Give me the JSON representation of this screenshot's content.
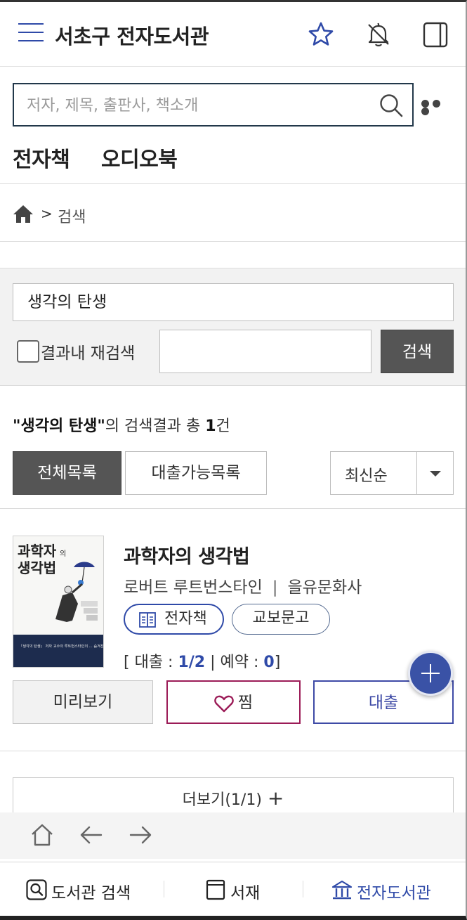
{
  "header": {
    "title": "서초구 전자도서관",
    "icons": [
      "menu-icon",
      "star-icon",
      "bell-off-icon",
      "bookshelf-icon"
    ]
  },
  "search": {
    "placeholder": "저자, 제목, 출판사, 책소개"
  },
  "media_tabs": [
    "전자책",
    "오디오북"
  ],
  "breadcrumb": {
    "separator": ">",
    "current": "검색"
  },
  "search_panel": {
    "query": "생각의 탄생",
    "within_label": "결과내 재검색",
    "button": "검색"
  },
  "results": {
    "query_quoted": "\"생각의 탄생\"",
    "summary_mid": "의 검색결과 총 ",
    "count": "1",
    "count_unit": "건"
  },
  "list_tabs": {
    "all": "전체목록",
    "available": "대출가능목록"
  },
  "sort": {
    "selected": "최신순"
  },
  "book": {
    "cover_title_1": "과학자",
    "cover_title_small": "의",
    "cover_title_2": "생각법",
    "cover_quote": "『생각의 탄생』 저자 교수의 루트번스타인의 ... 숨겨진 보물과 같은 책이다!",
    "title": "과학자의 생각법",
    "author": "로버트 루트번스타인",
    "meta_sep": "|",
    "publisher": "을유문화사",
    "type_chip": "전자책",
    "vendor_chip": "교보문고",
    "loan_prefix": "[ 대출 : ",
    "loan_value": "1/2",
    "loan_sep": " |  예약 : ",
    "reserve_value": "0",
    "loan_suffix": "]",
    "preview_button": "미리보기",
    "wish_button": "찜",
    "borrow_button": "대출"
  },
  "more_button": {
    "label": "더보기(1/1)",
    "plus": "+"
  },
  "bottom_tabs": {
    "search": "도서관 검색",
    "shelf": "서재",
    "home": "전자도서관"
  },
  "colors": {
    "accent": "#2f4aa8",
    "dark_button": "#555555",
    "wish_border": "#9b1b57"
  }
}
